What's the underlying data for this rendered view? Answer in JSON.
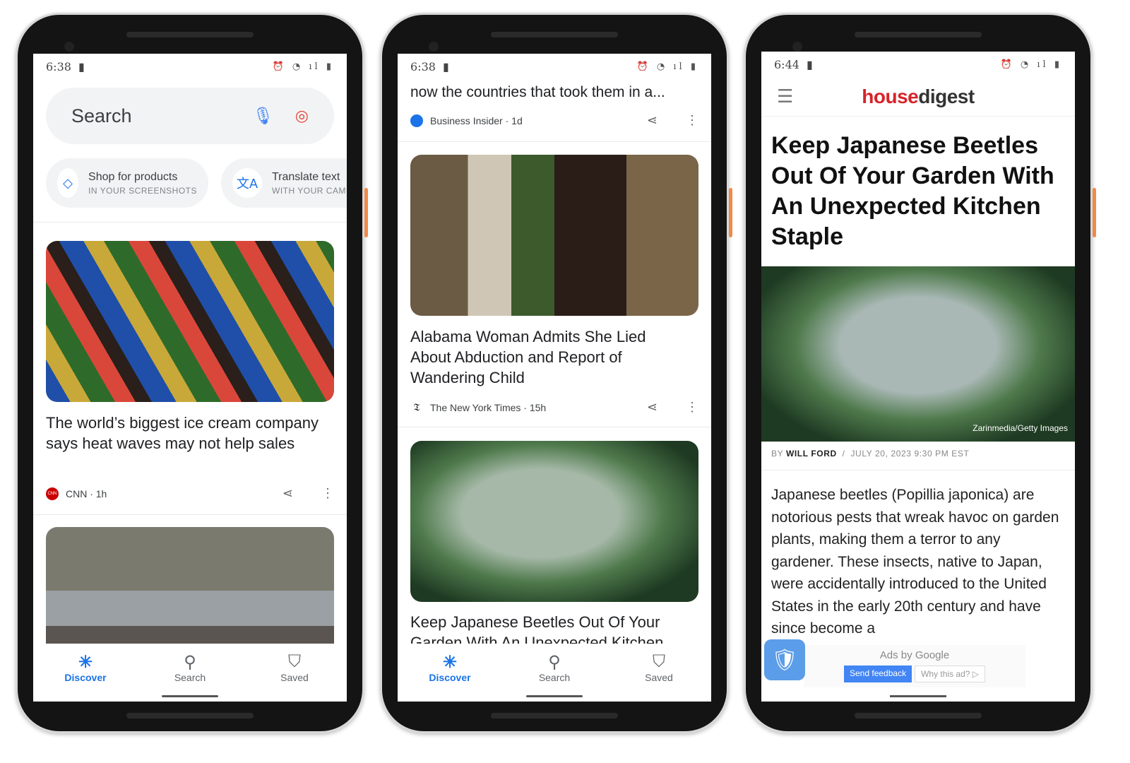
{
  "phone1": {
    "time": "6:38",
    "search_placeholder": "Search",
    "chips": [
      {
        "title": "Shop for products",
        "subtitle": "IN YOUR SCREENSHOTS"
      },
      {
        "title": "Translate text",
        "subtitle": "WITH YOUR CAMERA"
      }
    ],
    "card1": {
      "headline": "The world’s biggest ice cream company says heat waves may not help sales",
      "source": "CNN · 1h",
      "logo": "CNN"
    },
    "nav": [
      {
        "label": "Discover",
        "icon": "asterisk-icon",
        "active": true
      },
      {
        "label": "Search",
        "icon": "search-icon"
      },
      {
        "label": "Saved",
        "icon": "bookmark-icon"
      }
    ]
  },
  "phone2": {
    "time": "6:38",
    "prev_headline_tail": "now the countries that took them in a...",
    "prev_source": "Business Insider · 1d",
    "card1": {
      "headline": "Alabama Woman Admits She Lied About Abduction and Report of Wandering Child",
      "source": "The New York Times · 15h"
    },
    "card2": {
      "headline": "Keep Japanese Beetles Out Of Your Garden With An Unexpected Kitchen"
    },
    "nav": [
      {
        "label": "Discover",
        "active": true
      },
      {
        "label": "Search"
      },
      {
        "label": "Saved"
      }
    ]
  },
  "phone3": {
    "time": "6:44",
    "logo_part1": "house",
    "logo_part2": "digest",
    "brand_color": "#d8232a",
    "title": "Keep Japanese Beetles Out Of Your Garden With An Unexpected Kitchen Staple",
    "photo_credit": "Zarinmedia/Getty Images",
    "by": "BY",
    "author": "WILL FORD",
    "date": "JULY 20, 2023 9:30 PM EST",
    "body": "Japanese beetles (Popillia japonica) are notorious pests that wreak havoc on garden plants, making them a terror to any gardener. These insects, native to Japan, were accidentally introduced to the United States in the early 20th century and have since become a",
    "ad": {
      "label": "Ads by Google",
      "send_feedback": "Send feedback",
      "why": "Why this ad? ▷"
    }
  }
}
